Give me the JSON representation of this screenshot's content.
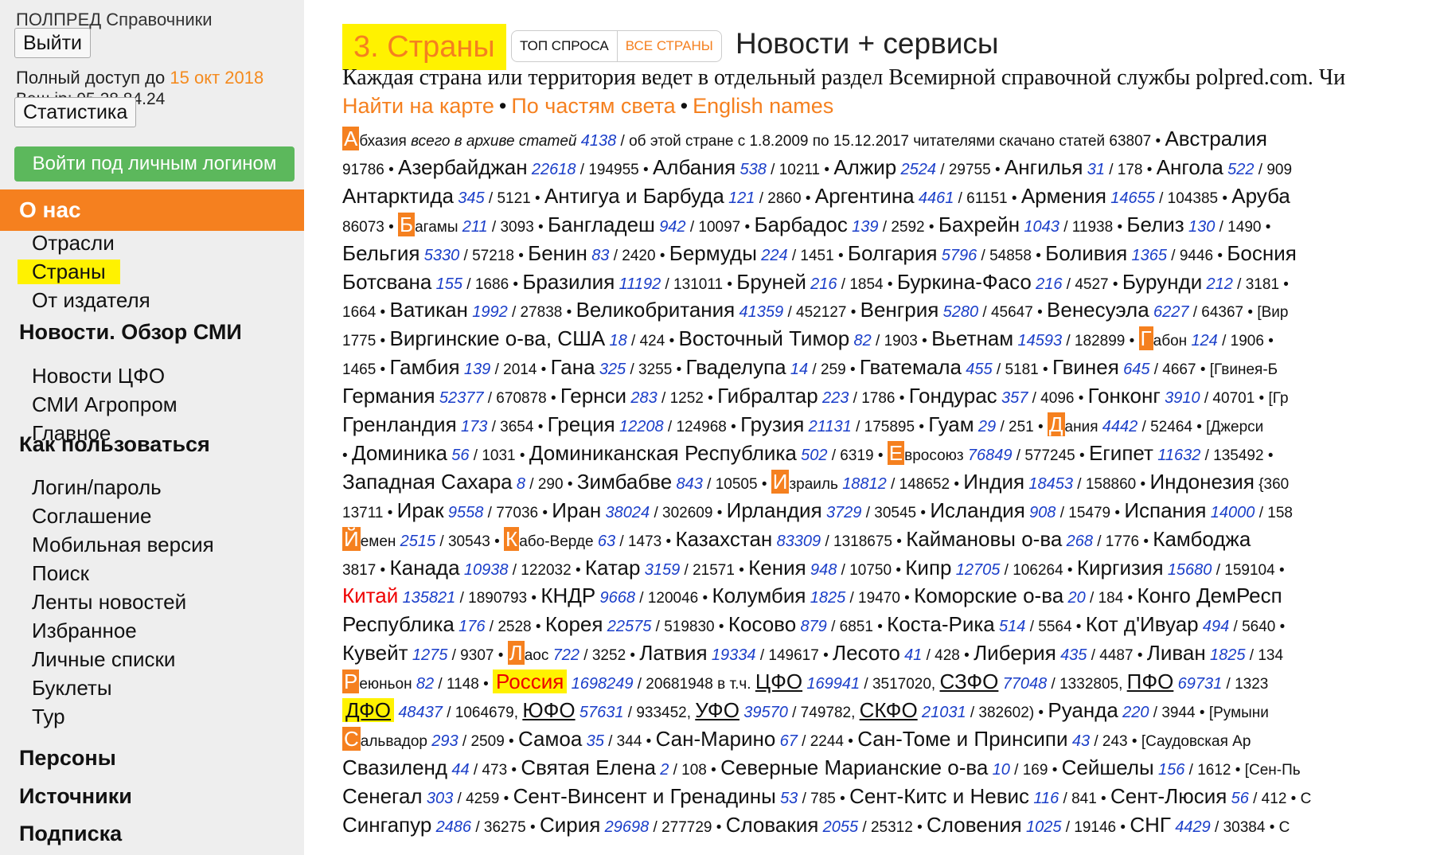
{
  "sidebar": {
    "brand": "ПОЛПРЕД Справочники",
    "logout": "Выйти",
    "access_prefix": "Полный доступ до",
    "access_date": "15 окт 2018",
    "ip": "Ваш ip: 95.28.84.24",
    "stats": "Статистика",
    "personal_login": "Войти под личным логином",
    "sections": [
      {
        "title": "О нас",
        "items": [
          "Отрасли",
          "Страны",
          "От издателя"
        ]
      },
      {
        "title": "Новости. Обзор СМИ",
        "items": [
          "Новости ЦФО",
          "СМИ Агропром",
          "Главное"
        ]
      },
      {
        "title": "Как пользоваться",
        "items": [
          "Логин/пароль",
          "Соглашение",
          "Мобильная версия",
          "Поиск",
          "Ленты новостей",
          "Избранное",
          "Личные списки",
          "Буклеты",
          "Тур"
        ]
      },
      {
        "title": "Персоны",
        "items": []
      },
      {
        "title": "Источники",
        "items": []
      },
      {
        "title": "Подписка",
        "items": []
      }
    ]
  },
  "main": {
    "title": "3. Страны",
    "tab_top": "ТОП СПРОСА",
    "tab_all": "ВСЕ СТРАНЫ",
    "news": "Новости + сервисы",
    "description": "Каждая страна или территория ведет в отдельный раздел Всемирной справочной службы polpred.com. Чи",
    "links": [
      "Найти на карте",
      "По частям света",
      "English names"
    ],
    "intro_archive": "всего в архиве статей",
    "intro_rest": "/ об этой стране с 1.8.2009 по 15.12.2017 читателями скачано статей 63807 •",
    "rows": [
      "[[А]]бхазия {i} {n4138} |ARCH| [Австралия]",
      "91786 • [Азербайджан] {22618} / 194955 • [Албания] {538} / 10211 • [Алжир] {2524} / 29755 • [Ангилья] {31} / 178 • [Ангола] {522} / 909",
      "[Антарктида] {345} / 5121 • [Антигуа и Барбуда] {121} / 2860 • [Аргентина] {4461} / 61151 • [Армения] {14655} / 104385 • [Аруба]",
      "86073 • [[Б]]агамы {211} / 3093 • [Бангладеш] {942} / 10097 • [Барбадос] {139} / 2592 • [Бахрейн] {1043} / 11938 • [Белиз] {130} / 1490 •",
      "[Бельгия] {5330} / 57218 • [Бенин] {83} / 2420 • [Бермуды] {224} / 1451 • [Болгария] {5796} / 54858 • [Боливия] {1365} / 9446 • [Босния]",
      "[Ботсвана] {155} / 1686 • [Бразилия] {11192} / 131011 • [Бруней] {216} / 1854 • [Буркина-Фасо] {216} / 4527 • [Бурунди] {212} / 3181 •",
      "1664 • [Ватикан] {1992} / 27838 • [Великобритания] {41359} / 452127 • [Венгрия] {5280} / 45647 • [Венесуэла] {6227} / 64367 • [Вир",
      "1775 • [Виргинские о-ва, США] {18} / 424 • [Восточный Тимор] {82} / 1903 • [Вьетнам] {14593} / 182899 • [[Г]]абон {124} / 1906 •",
      "1465 • [Гамбия] {139} / 2014 • [Гана] {325} / 3255 • [Гваделупа] {14} / 259 • [Гватемала] {455} / 5181 • [Гвинея] {645} / 4667 • [Гвинея-Б",
      "[Германия] {52377} / 670878 • [Гернси] {283} / 1252 • [Гибралтар] {223} / 1786 • [Гондурас] {357} / 4096 • [Гонконг] {3910} / 40701 • [Гр",
      "[Гренландия] {173} / 3654 • [Греция] {12208} / 124968 • [Грузия] {21131} / 175895 • [Гуам] {29} / 251 • [[Д]]ания {4442} / 52464 • [Джерси",
      "• [Доминика] {56} / 1031 • [Доминиканская Республика] {502} / 6319 • [[Е]]вросоюз {76849} / 577245 • [Египет] {11632} / 135492 •",
      "[Западная Сахара] {8} / 290 • [Зимбабве] {843} / 10505 • [[И]]зраиль {18812} / 148652 • [Индия] {18453} / 158860 • [Индонезия] {360",
      "13711 • [Ирак] {9558} / 77036 • [Иран] {38024} / 302609 • [Ирландия] {3729} / 30545 • [Исландия] {908} / 15479 • [Испания] {14000} / 158",
      "[[Й]]емен {2515} / 30543 • [[К]]або-Верде {63} / 1473 • [Казахстан] {83309} / 1318675 • [Каймановы о-ва] {268} / 1776 • [Камбоджа]",
      "3817 • [Канада] {10938} / 122032 • [Катар] {3159} / 21571 • [Кения] {948} / 10750 • [Кипр] {12705} / 106264 • [Киргизия] {15680} / 159104 •",
      "((Китай)) {135821} / 1890793 • [КНДР] {9668} / 120046 • [Колумбия] {1825} / 19470 • [Коморские о-ва] {20} / 184 • [Конго ДемРесп]",
      "[Республика] {176} / 2528 • [Корея] {22575} / 519830 • [Косово] {879} / 6851 • [Коста-Рика] {514} / 5564 • [Кот д'Ивуар] {494} / 5640 •",
      "[Кувейт] {1275} / 9307 • [[Л]]аос {722} / 3252 • [Латвия] {19334} / 149617 • [Лесото] {41} / 428 • [Либерия] {435} / 4487 • [Ливан] {1825} / 134",
      "[[Р]]еюньон {82} / 1148 • (!Россия!) {1698249} / 20681948 <(в т.ч.)> _ЦФО_ {169941} / 3517020, _СЗФО_ {77048} / 1332805, _ПФО_ {69731} / 1323",
      "=ДФО= {48437} / 1064679, _ЮФО_ {57631} / 933452, _УФО_ {39570} / 749782, _СКФО_ {21031} / 382602) • [Руанда] {220} / 3944 • [Румыни",
      "[[С]]альвадор {293} / 2509 • [Самоа] {35} / 344 • [Сан-Марино] {67} / 2244 • [Сан-Томе и Принсипи] {43} / 243 • [Саудовская Ар",
      "[Свазиленд] {44} / 473 • [Святая Елена] {2} / 108 • [Северные Марианские о-ва] {10} / 169 • [Сейшелы] {156} / 1612 • [Сен-Пь",
      "[Сенегал] {303} / 4259 • [Сент-Винсент и Гренадины] {53} / 785 • [Сент-Китс и Невис] {116} / 841 • [Сент-Люсия] {56} / 412 • С",
      "[Сингапур] {2486} / 36275 • [Сирия] {29698} / 277729 • [Словакия] {2055} / 25312 • [Словения] {1025} / 19146 • [СНГ] {4429} / 30384 • С"
    ]
  }
}
